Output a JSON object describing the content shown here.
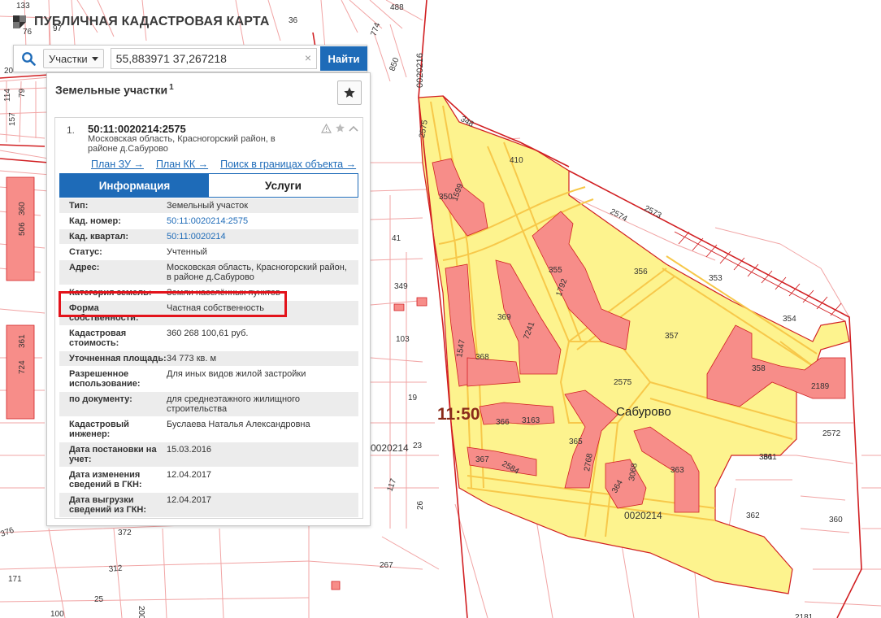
{
  "app": {
    "title": "ПУБЛИЧНАЯ КАДАСТРОВАЯ КАРТА",
    "logo_icon": "pkk-logo-icon"
  },
  "search": {
    "type_selector": "Участки",
    "query": "55,883971 37,267218",
    "clear": "×",
    "button": "Найти"
  },
  "panel": {
    "title": "Земельные участки",
    "count": "1",
    "favorite_icon": "star-icon",
    "result": {
      "index": "1.",
      "cadastral_number": "50:11:0020214:2575",
      "address": "Московская область, Красногорский район, в районе д.Сабурово",
      "links": [
        "План ЗУ →",
        "План КК →",
        "Поиск в границах объекта →"
      ],
      "tabs": [
        {
          "label": "Информация",
          "active": true
        },
        {
          "label": "Услуги",
          "active": false
        }
      ],
      "info": [
        {
          "label": "Тип:",
          "value": "Земельный участок"
        },
        {
          "label": "Кад. номер:",
          "value": "50:11:0020214:2575",
          "link": true
        },
        {
          "label": "Кад. квартал:",
          "value": "50:11:0020214",
          "link": true
        },
        {
          "label": "Статус:",
          "value": "Учтенный"
        },
        {
          "label": "Адрес:",
          "value": "Московская область, Красногорский район, в районе д.Сабурово"
        },
        {
          "label": "Категория земель:",
          "value": "Земли населённых пунктов"
        },
        {
          "label": "Форма собственности:",
          "value": "Частная собственность"
        },
        {
          "label": "Кадастровая стоимость:",
          "value": "360 268 100,61 руб."
        },
        {
          "label": "Уточненная площадь:",
          "value": "34 773 кв. м"
        },
        {
          "label": "Разрешенное использование:",
          "value": "Для иных видов жилой застройки"
        },
        {
          "label": "по документу:",
          "value": "для среднеэтажного жилищного строительства"
        },
        {
          "label": "Кадастровый инженер:",
          "value": "Буслаева Наталья Александровна"
        },
        {
          "label": "Дата постановки на учет:",
          "value": "15.03.2016"
        },
        {
          "label": "Дата изменения сведений в ГКН:",
          "value": "12.04.2017"
        },
        {
          "label": "Дата выгрузки сведений из ГКН:",
          "value": "12.04.2017"
        }
      ]
    }
  },
  "map": {
    "place_name": "Сабурово",
    "quarter_label": "11:50",
    "labels": [
      "133",
      "76",
      "97",
      "36",
      "488",
      "0020216",
      "774",
      "850",
      "20",
      "114",
      "79",
      "157",
      "348",
      "2575",
      "410",
      "350",
      "1599",
      "2574",
      "2573",
      "41",
      "355",
      "1792",
      "356",
      "353",
      "349",
      "369",
      "1547",
      "357",
      "354",
      "103",
      "7241",
      "368",
      "2575",
      "358",
      "2189",
      "19",
      "361",
      "367",
      "2584",
      "366",
      "3163",
      "365",
      "2768",
      "3068",
      "363",
      "364",
      "2572",
      "23",
      "0020214",
      "26",
      "117",
      "361",
      "362",
      "360",
      "372",
      "267",
      "312",
      "171",
      "25",
      "200",
      "376",
      "100",
      "506",
      "360",
      "724",
      "361",
      "2181",
      "0020214"
    ],
    "colors": {
      "parcel": "#fdf38e",
      "building": "#f78d89",
      "boundary": "#d11f22",
      "line": "#f3a9a9",
      "road": "#f7c84a"
    }
  }
}
